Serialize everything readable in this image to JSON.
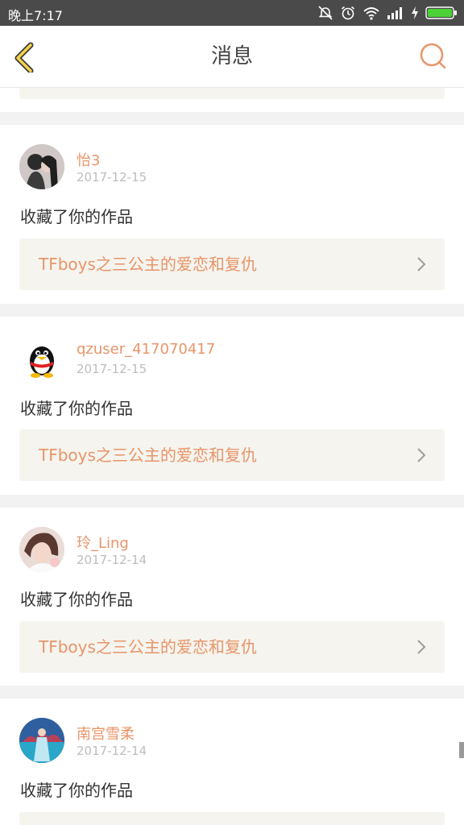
{
  "status_bar": {
    "time": "晚上7:17"
  },
  "header": {
    "title": "消息"
  },
  "notifications": [
    {
      "username": "怡3",
      "date": "2017-12-15",
      "action": "收藏了你的作品",
      "work_title": "TFboys之三公主的爱恋和复仇"
    },
    {
      "username": "qzuser_417070417",
      "date": "2017-12-15",
      "action": "收藏了你的作品",
      "work_title": "TFboys之三公主的爱恋和复仇"
    },
    {
      "username": "玲_Ling",
      "date": "2017-12-14",
      "action": "收藏了你的作品",
      "work_title": "TFboys之三公主的爱恋和复仇"
    },
    {
      "username": "南宫雪柔",
      "date": "2017-12-14",
      "action": "收藏了你的作品",
      "work_title": ""
    }
  ],
  "colors": {
    "accent": "#e8956a",
    "status_bar": "#4a4a4a",
    "card_box": "#f5f4ee",
    "background": "#f2f2f2"
  }
}
